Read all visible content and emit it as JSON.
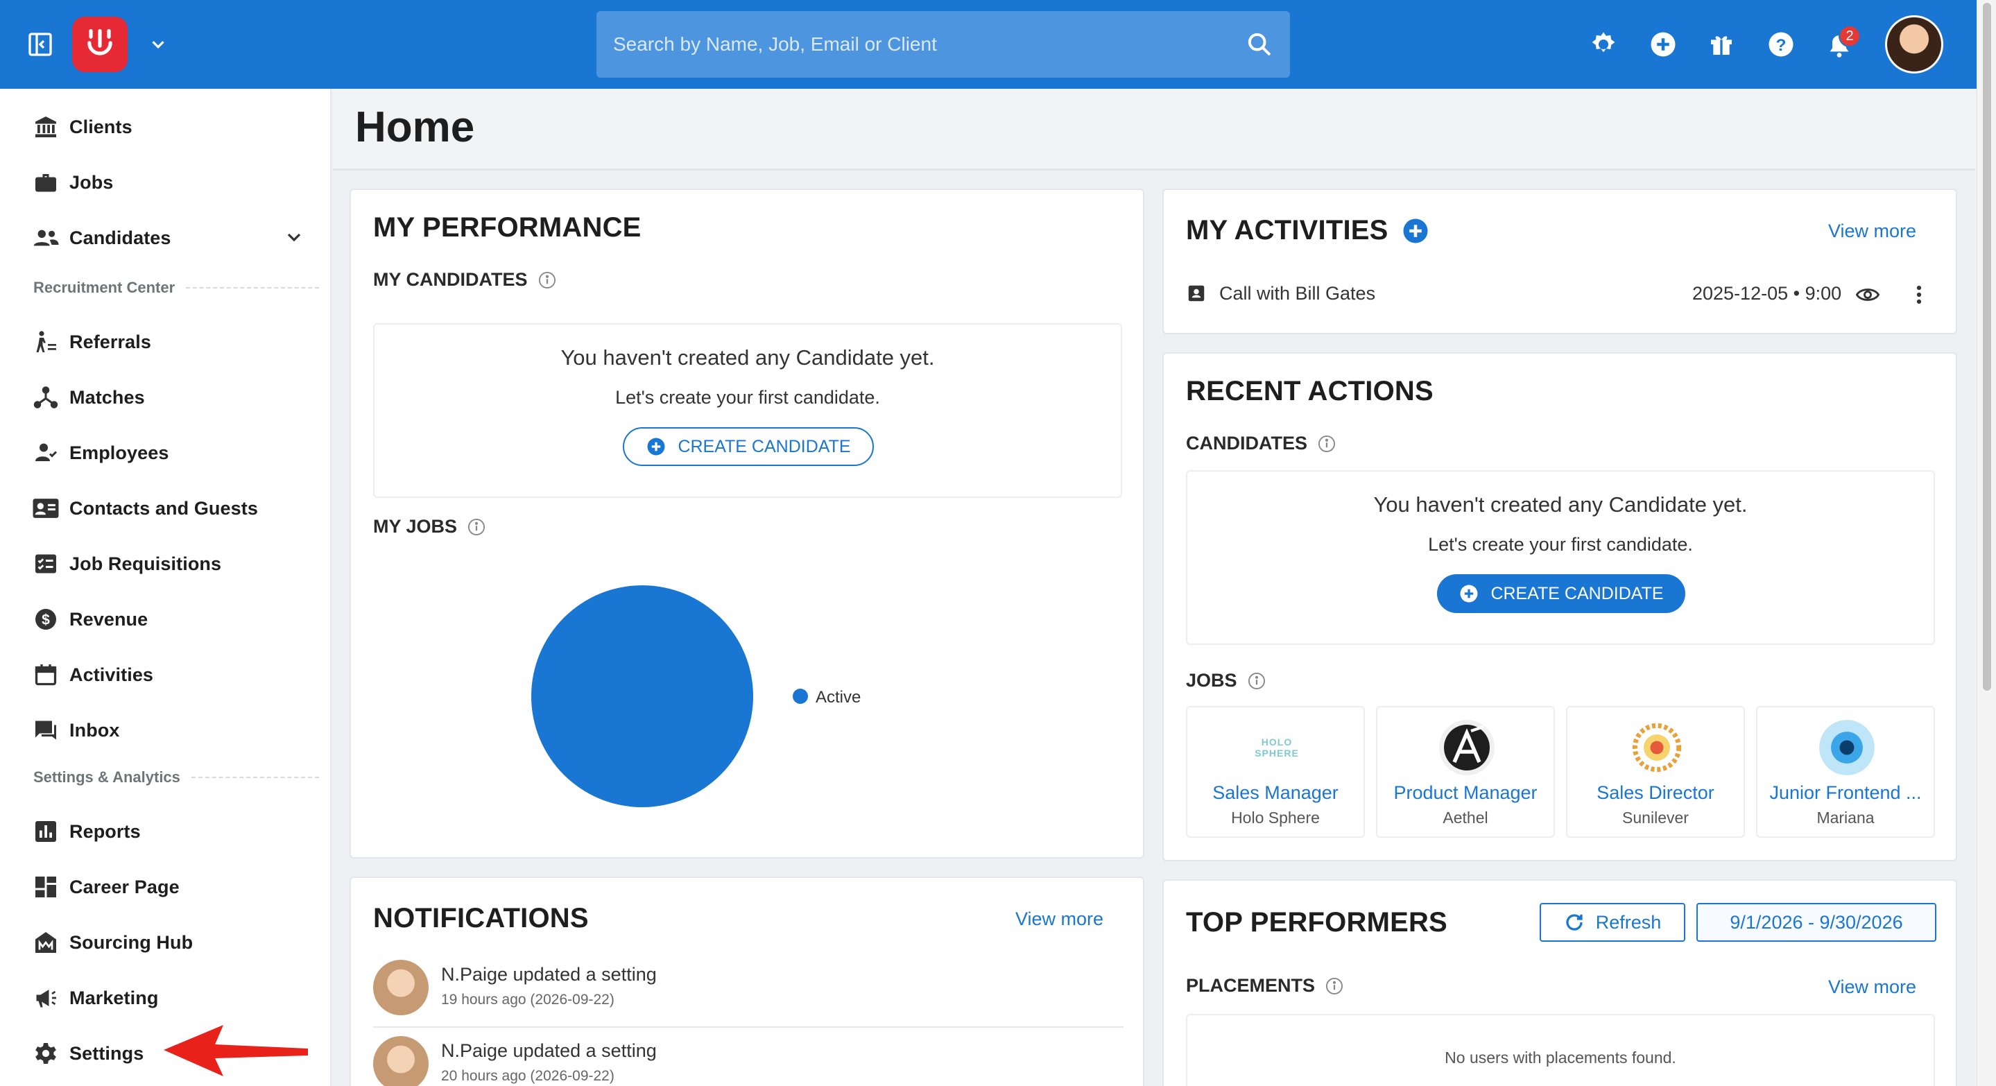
{
  "topbar": {
    "search_placeholder": "Search by Name, Job, Email or Client",
    "notification_count": "2"
  },
  "sidebar": {
    "items": [
      {
        "label": "Clients"
      },
      {
        "label": "Jobs"
      },
      {
        "label": "Candidates"
      },
      {
        "label": "Referrals"
      },
      {
        "label": "Matches"
      },
      {
        "label": "Employees"
      },
      {
        "label": "Contacts and Guests"
      },
      {
        "label": "Job Requisitions"
      },
      {
        "label": "Revenue"
      },
      {
        "label": "Activities"
      },
      {
        "label": "Inbox"
      },
      {
        "label": "Reports"
      },
      {
        "label": "Career Page"
      },
      {
        "label": "Sourcing Hub"
      },
      {
        "label": "Marketing"
      },
      {
        "label": "Settings"
      }
    ],
    "sections": {
      "recruitment": "Recruitment Center",
      "settings": "Settings & Analytics"
    }
  },
  "page": {
    "title": "Home"
  },
  "performance": {
    "title": "MY PERFORMANCE",
    "candidates_title": "MY CANDIDATES",
    "empty_title": "You haven't created any Candidate yet.",
    "empty_sub": "Let's create your first candidate.",
    "create_label": "CREATE CANDIDATE",
    "jobs_title": "MY JOBS"
  },
  "chart_data": {
    "type": "pie",
    "categories": [
      "Active"
    ],
    "values": [
      100
    ],
    "colors": [
      "#1976d2"
    ],
    "legend_position": "right"
  },
  "activities": {
    "title": "MY ACTIVITIES",
    "view_more": "View more",
    "item_title": "Call with Bill Gates",
    "item_time": "2025-12-05 • 9:00"
  },
  "recent": {
    "title": "RECENT ACTIONS",
    "candidates_title": "CANDIDATES",
    "empty_title": "You haven't created any Candidate yet.",
    "empty_sub": "Let's create your first candidate.",
    "create_label": "CREATE CANDIDATE",
    "jobs_title": "JOBS",
    "jobs": [
      {
        "title": "Sales Manager",
        "client": "Holo Sphere",
        "logo_text": "HOLO SPHERE"
      },
      {
        "title": "Product Manager",
        "client": "Aethel"
      },
      {
        "title": "Sales Director",
        "client": "Sunilever"
      },
      {
        "title": "Junior Frontend ...",
        "client": "Mariana"
      }
    ]
  },
  "notifications": {
    "title": "NOTIFICATIONS",
    "view_more": "View more",
    "items": [
      {
        "text": "N.Paige updated a setting",
        "time": "19 hours ago (2026-09-22)"
      },
      {
        "text": "N.Paige updated a setting",
        "time": "20 hours ago (2026-09-22)"
      }
    ]
  },
  "top_performers": {
    "title": "TOP PERFORMERS",
    "refresh": "Refresh",
    "date_range": "9/1/2026 - 9/30/2026",
    "placements_title": "PLACEMENTS",
    "view_more": "View more",
    "empty": "No users with placements found."
  },
  "colors": {
    "primary": "#1976d2",
    "logo": "#e52a36",
    "arrow": "#e8211a"
  }
}
